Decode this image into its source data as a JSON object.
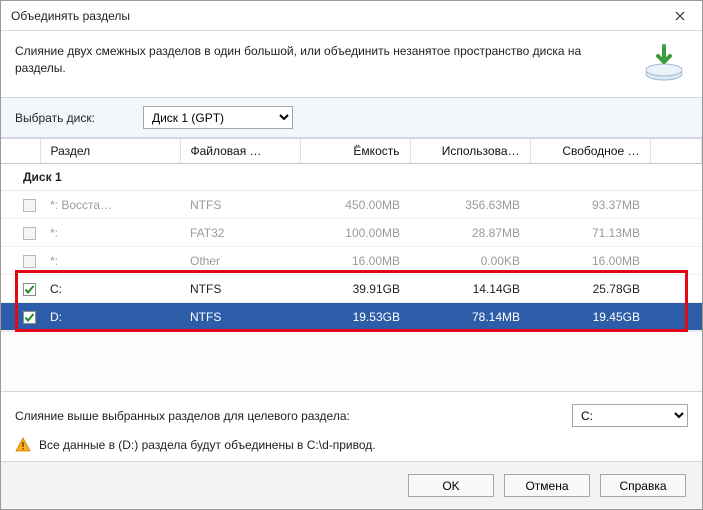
{
  "window": {
    "title": "Объединять разделы",
    "description": "Слияние двух смежных разделов в один большой, или объединить незанятое пространство диска на разделы."
  },
  "disk_selector": {
    "label": "Выбрать диск:",
    "selected": "Диск 1 (GPT)"
  },
  "columns": {
    "partition": "Раздел",
    "filesystem": "Файловая …",
    "capacity": "Ёмкость",
    "used": "Использова…",
    "free": "Свободное …"
  },
  "group_label": "Диск 1",
  "rows": [
    {
      "checked": false,
      "enabled": false,
      "selected": false,
      "partition": "*: Восста…",
      "fs": "NTFS",
      "cap": "450.00MB",
      "used": "356.63MB",
      "free": "93.37MB"
    },
    {
      "checked": false,
      "enabled": false,
      "selected": false,
      "partition": "*:",
      "fs": "FAT32",
      "cap": "100.00MB",
      "used": "28.87MB",
      "free": "71.13MB"
    },
    {
      "checked": false,
      "enabled": false,
      "selected": false,
      "partition": "*:",
      "fs": "Other",
      "cap": "16.00MB",
      "used": "0.00KB",
      "free": "16.00MB"
    },
    {
      "checked": true,
      "enabled": true,
      "selected": false,
      "partition": "C:",
      "fs": "NTFS",
      "cap": "39.91GB",
      "used": "14.14GB",
      "free": "25.78GB"
    },
    {
      "checked": true,
      "enabled": true,
      "selected": true,
      "partition": "D:",
      "fs": "NTFS",
      "cap": "19.53GB",
      "used": "78.14MB",
      "free": "19.45GB"
    }
  ],
  "merge": {
    "label": "Слияние выше выбранных разделов для целевого раздела:",
    "target": "C:"
  },
  "warning": "Все данные в (D:) раздела будут объединены в C:\\d-привод.",
  "buttons": {
    "ok": "OK",
    "cancel": "Отмена",
    "help": "Справка"
  }
}
